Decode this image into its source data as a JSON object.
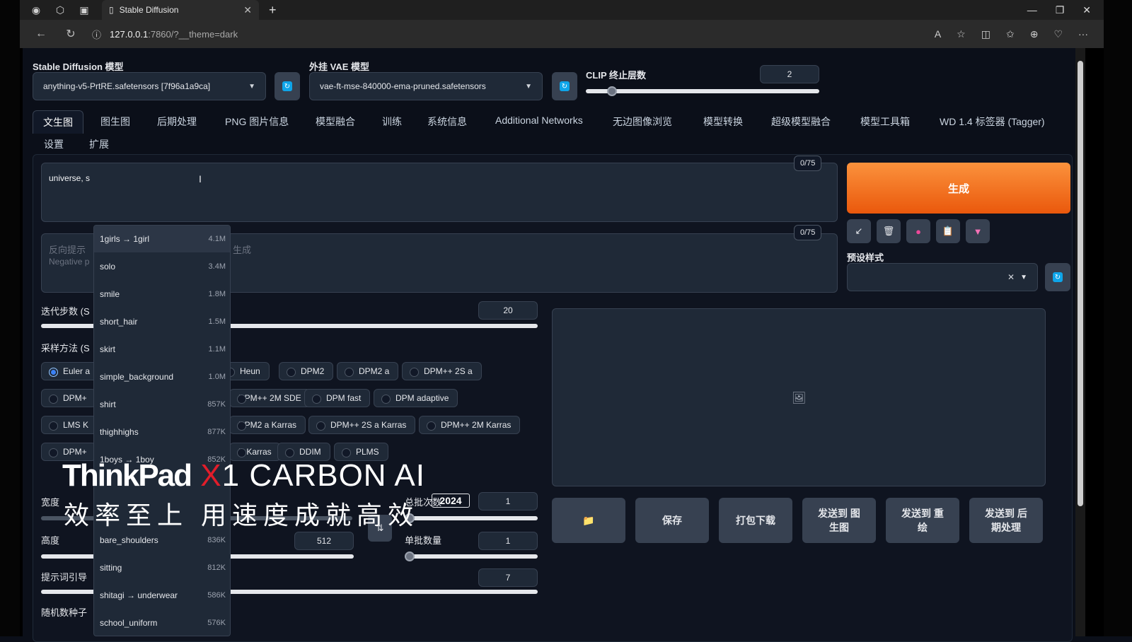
{
  "browser": {
    "tab_title": "Stable Diffusion",
    "url_host": "127.0.0.1",
    "url_path": ":7860/?__theme=dark"
  },
  "top": {
    "sd_model_label": "Stable Diffusion 模型",
    "sd_model_value": "anything-v5-PrtRE.safetensors [7f96a1a9ca]",
    "vae_label": "外挂 VAE 模型",
    "vae_value": "vae-ft-mse-840000-ema-pruned.safetensors",
    "clip_label": "CLIP 终止层数",
    "clip_value": "2"
  },
  "tabs": [
    "文生图",
    "图生图",
    "后期处理",
    "PNG 图片信息",
    "模型融合",
    "训练",
    "系统信息",
    "Additional Networks",
    "无边图像浏览",
    "模型转换",
    "超级模型融合",
    "模型工具箱",
    "WD 1.4 标签器 (Tagger)",
    "设置",
    "扩展"
  ],
  "prompt": {
    "text": "universe, s",
    "counter": "0/75"
  },
  "neg_prompt": {
    "placeholder_a": "反向提示",
    "placeholder_b": "Negative p",
    "counter": "0/75",
    "tail": "生成"
  },
  "generate_label": "生成",
  "style_label": "预设样式",
  "steps": {
    "label": "迭代步数 (S",
    "value": "20"
  },
  "sampler": {
    "label": "采样方法 (S",
    "options": [
      "Euler a",
      "Heun",
      "DPM2",
      "DPM2 a",
      "DPM++ 2S a",
      "DPM+",
      "DPM++ 2M SDE",
      "DPM fast",
      "DPM adaptive",
      "LMS K",
      "DPM2 a Karras",
      "DPM++ 2S a Karras",
      "DPM++ 2M Karras",
      "DPM+",
      "E Karras",
      "DDIM",
      "PLMS"
    ]
  },
  "left_labels": {
    "width": "宽度",
    "height": "高度",
    "cfg": "提示词引导",
    "seed": "随机数种子"
  },
  "height_value": "512",
  "batch_count": {
    "label": "总批次数",
    "value": "1"
  },
  "batch_size": {
    "label": "单批数量",
    "value": "1"
  },
  "cfg_value": "7",
  "actions": [
    "保存",
    "打包下载",
    "发送到 图生图",
    "发送到 重绘",
    "发送到 后期处理"
  ],
  "autocomplete": [
    {
      "name": "1girls → 1girl",
      "count": "4.1M"
    },
    {
      "name": "solo",
      "count": "3.4M"
    },
    {
      "name": "smile",
      "count": "1.8M"
    },
    {
      "name": "short_hair",
      "count": "1.5M"
    },
    {
      "name": "skirt",
      "count": "1.1M"
    },
    {
      "name": "simple_background",
      "count": "1.0M"
    },
    {
      "name": "shirt",
      "count": "857K"
    },
    {
      "name": "thighhighs",
      "count": "877K"
    },
    {
      "name": "1boys → 1boy",
      "count": "852K"
    },
    {
      "name": "bare_shoulders",
      "count": "836K"
    },
    {
      "name": "sitting",
      "count": "812K"
    },
    {
      "name": "shitagi → underwear",
      "count": "586K"
    },
    {
      "name": "school_uniform",
      "count": "576K"
    }
  ],
  "overlay": {
    "brand_a": "ThinkPad",
    "brand_x": "X",
    "brand_b": "1 CARBON AI",
    "slogan": "效率至上 用速度成就高效",
    "badge": "2024"
  }
}
